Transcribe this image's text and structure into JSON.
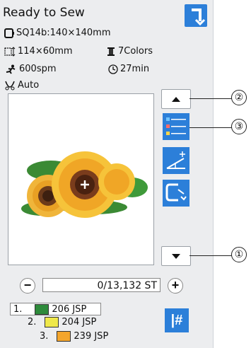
{
  "title": "Ready to Sew",
  "info": {
    "hoop": "SQ14b:140×140mm",
    "size": "114×60mm",
    "colors": "7Colors",
    "speed": "600spm",
    "time": "27min",
    "cut": "Auto"
  },
  "counter": {
    "value": "0/13,132 ST",
    "minus": "−",
    "plus": "+"
  },
  "colors_list": [
    {
      "num": "1.",
      "swatch": "#2e8b3b",
      "label": "206 JSP"
    },
    {
      "num": "2.",
      "swatch": "#efe84a",
      "label": "204 JSP"
    },
    {
      "num": "3.",
      "swatch": "#f3a52c",
      "label": "239 JSP"
    }
  ],
  "jump_label": "|#",
  "callouts": {
    "c1": "①",
    "c2": "②",
    "c3": "③"
  },
  "accent_color": "#2c7fd9"
}
